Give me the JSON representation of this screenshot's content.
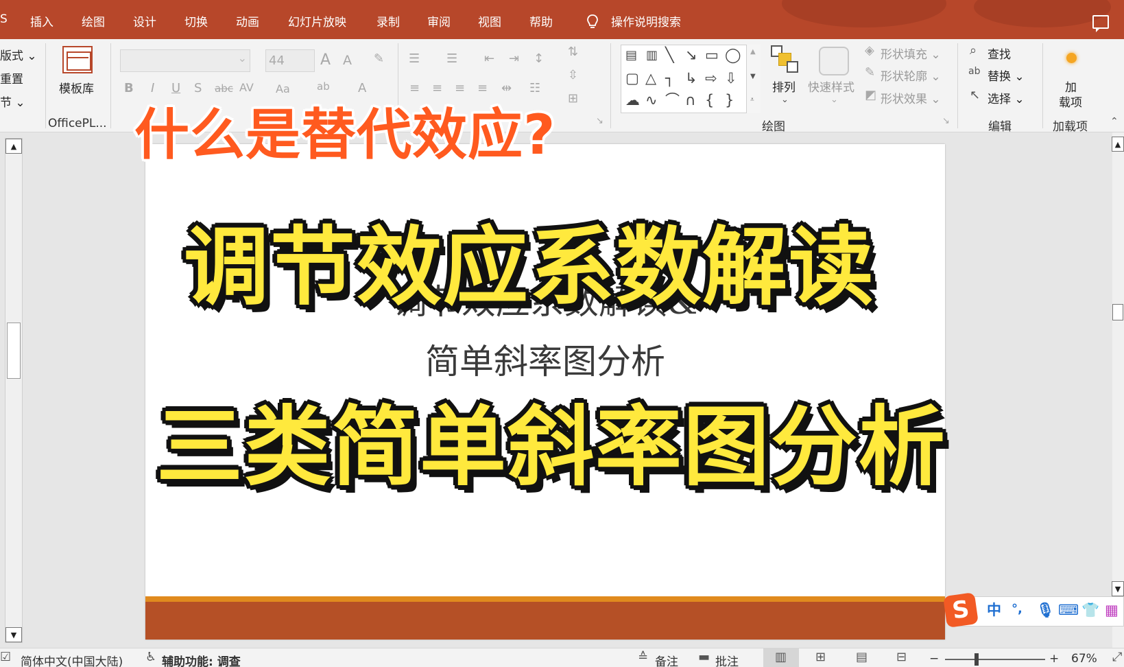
{
  "menu": {
    "tabs": [
      "S",
      "插入",
      "绘图",
      "设计",
      "切换",
      "动画",
      "幻灯片放映",
      "录制",
      "审阅",
      "视图",
      "帮助"
    ],
    "search_label": "操作说明搜索"
  },
  "ribbon": {
    "slides_group": {
      "layout_label": "版式",
      "reset_label": "重置",
      "section_label": "节"
    },
    "officeplus": {
      "template_label": "模板库",
      "group_label": "OfficePL..."
    },
    "font": {
      "font_name": "",
      "font_size": "44"
    },
    "drawing": {
      "arrange_label": "排列",
      "quick_styles_label": "快速样式",
      "shape_fill_label": "形状填充",
      "shape_outline_label": "形状轮廓",
      "shape_effects_label": "形状效果",
      "group_label": "绘图"
    },
    "editing": {
      "find_label": "查找",
      "replace_label": "替换",
      "select_label": "选择",
      "group_label": "编辑"
    },
    "addins": {
      "button_line1": "加",
      "button_line2": "载项",
      "group_label": "加载项"
    }
  },
  "slide": {
    "subtitle_line1": "调节效应系数解读&",
    "subtitle_line2": "简单斜率图分析"
  },
  "overlay": {
    "question": "什么是替代效应?",
    "title_line1": "调节效应系数解读",
    "title_line2": "三类简单斜率图分析"
  },
  "ime": {
    "logo": "S",
    "mode": "中",
    "punct": "°,"
  },
  "statusbar": {
    "language": "简体中文(中国大陆)",
    "accessibility": "辅助功能: 调查",
    "notes_label": "备注",
    "comments_label": "批注",
    "zoom_minus": "−",
    "zoom_plus": "+",
    "zoom_level": "67%"
  },
  "colors": {
    "brand": "#b7472a",
    "title_yellow": "#ffe93d",
    "question_orange": "#ff5a1f",
    "footer": "#b55026"
  }
}
